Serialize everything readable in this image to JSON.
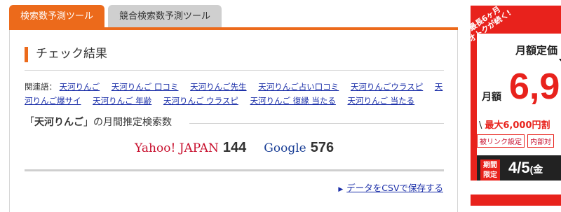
{
  "tabs": [
    {
      "label": "検索数予測ツール"
    },
    {
      "label": "競合検索数予測ツール"
    }
  ],
  "heading": "チェック結果",
  "related": {
    "label": "関連語：",
    "keywords": [
      "天河りんご",
      "天河りんご 口コミ",
      "天河りんご先生",
      "天河りんご占い口コミ",
      "天河りんごウラスピ",
      "天河りんご爆サイ",
      "天河りんご 年齢",
      "天河りんご ウラスピ",
      "天河りんご 復縁 当たる",
      "天河りんご 当たる"
    ]
  },
  "volume": {
    "open_quote": "「",
    "keyword": "天河りんご",
    "suffix": "」の月間推定検索数",
    "yahoo_label": "Yahoo! JAPAN",
    "yahoo_value": "144",
    "google_label": "Google",
    "google_value": "576"
  },
  "csv_link": "データをCSVで保存する",
  "ad": {
    "ribbon_line1": "最長6ヶ月",
    "ribbon_line2": "オトクが続く!",
    "teitei": "月額定価",
    "getsugaku": "月額",
    "price": "6,9",
    "line": "最大6,000円割",
    "tag1": "被リンク設定",
    "tag2": "内部対",
    "gentei": "期間限定",
    "date": "4/5",
    "date_suffix": "(金"
  },
  "colors": {
    "accent": "#ec6a1b",
    "link": "#1a2ea8",
    "yahoo": "#c8102e",
    "google": "#1a3f96"
  }
}
